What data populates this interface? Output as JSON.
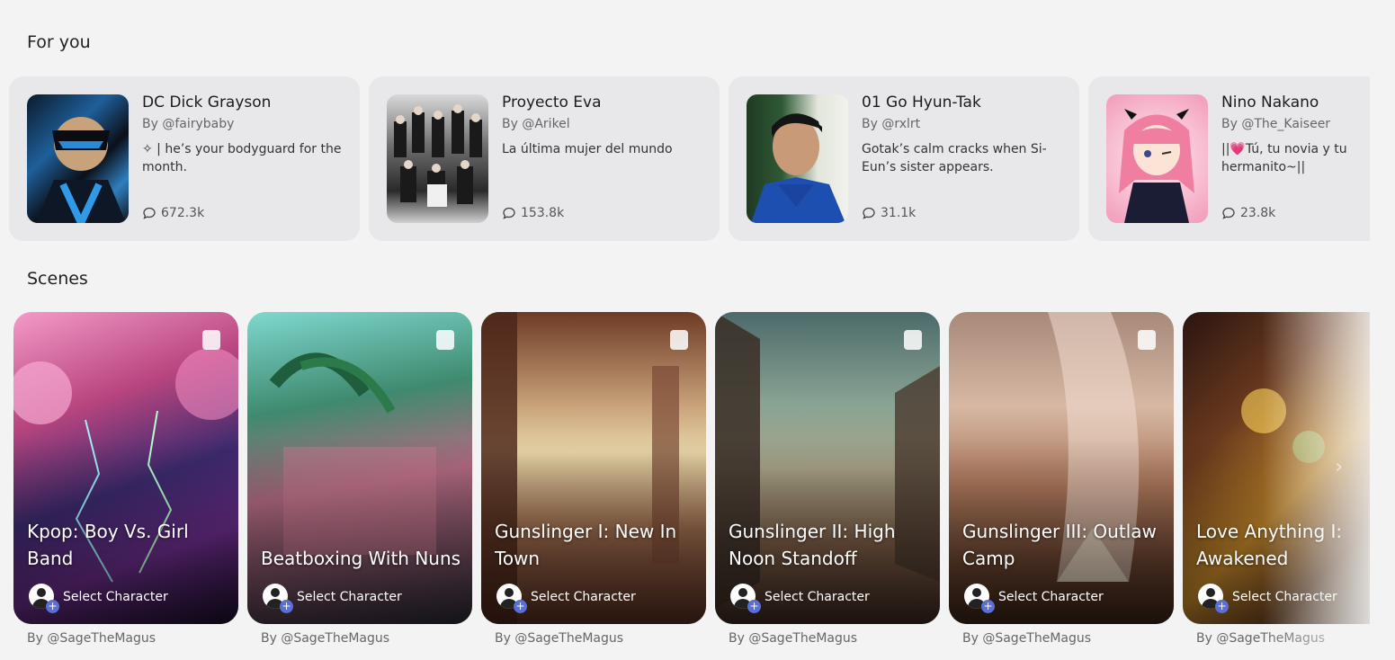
{
  "sections": {
    "for_you_title": "For you",
    "scenes_title": "Scenes"
  },
  "for_you": [
    {
      "name": "DC Dick Grayson",
      "by": "By @fairybaby",
      "desc": "✧ | he’s your bodyguard for the month.",
      "count": "672.3k"
    },
    {
      "name": "Proyecto Eva",
      "by": "By @Arikel",
      "desc": "La última mujer del mundo",
      "count": "153.8k"
    },
    {
      "name": "01 Go Hyun-Tak",
      "by": "By @rxlrt",
      "desc": "Gotak’s calm cracks when Si-Eun’s sister appears.",
      "count": "31.1k"
    },
    {
      "name": "Nino Nakano",
      "by": "By @The_Kaiseer",
      "desc": "||💗Tú, tu novia y tu hermanito~||",
      "count": "23.8k"
    }
  ],
  "scenes": [
    {
      "title": "Kpop: Boy Vs. Girl Band",
      "select": "Select Character",
      "by": "By @SageTheMagus"
    },
    {
      "title": "Beatboxing With Nuns",
      "select": "Select Character",
      "by": "By @SageTheMagus"
    },
    {
      "title": "Gunslinger I: New In Town",
      "select": "Select Character",
      "by": "By @SageTheMagus"
    },
    {
      "title": "Gunslinger II: High Noon Standoff",
      "select": "Select Character",
      "by": "By @SageTheMagus"
    },
    {
      "title": "Gunslinger III: Outlaw Camp",
      "select": "Select Character",
      "by": "By @SageTheMagus"
    },
    {
      "title": "Love Anything I: Awakened",
      "select": "Select Character",
      "by": "By @SageTheMagus"
    }
  ],
  "icons": {
    "chat": "chat-bubble-icon",
    "scene_badge": "sparkle-badge-icon",
    "avatar_add": "avatar-plus-icon"
  }
}
